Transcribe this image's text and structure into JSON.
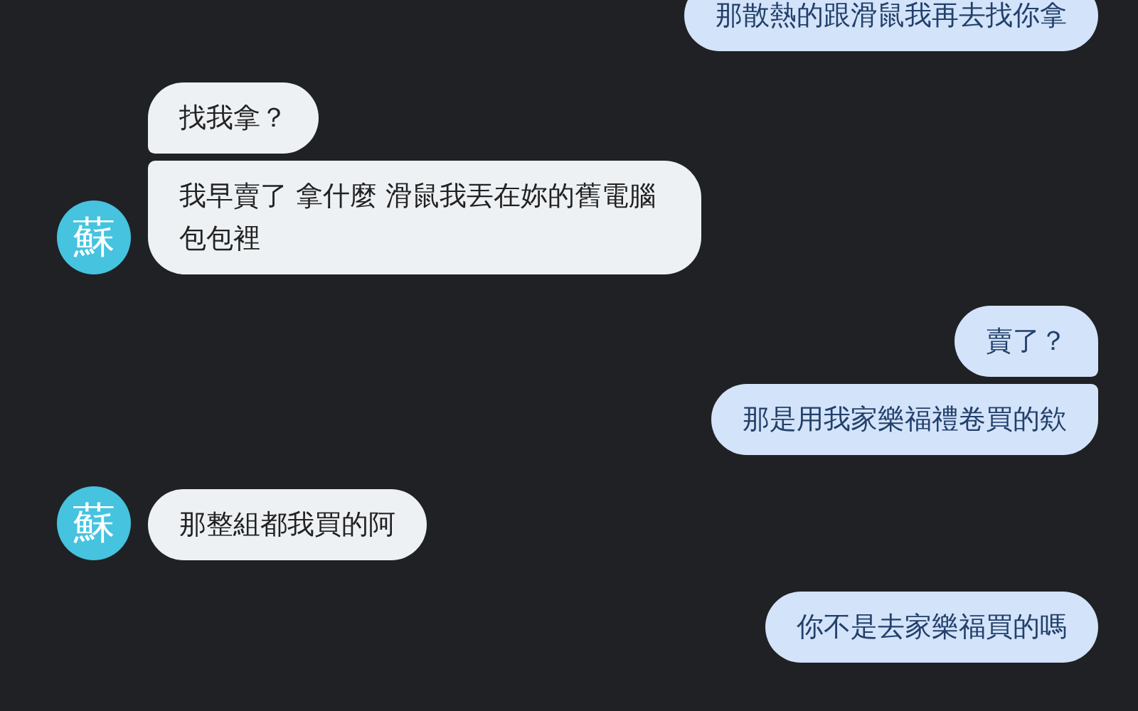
{
  "messages": [
    {
      "kind": "sent",
      "bubbles": [
        "那散熱的跟滑鼠我再去找你拿"
      ]
    },
    {
      "kind": "received",
      "avatar": "蘇",
      "bubbles": [
        "找我拿？",
        "我早賣了  拿什麼  滑鼠我丟在妳的舊電腦包包裡"
      ]
    },
    {
      "kind": "sent",
      "bubbles": [
        "賣了？",
        "那是用我家樂福禮卷買的欸"
      ]
    },
    {
      "kind": "received",
      "avatar": "蘇",
      "bubbles": [
        "那整組都我買的阿"
      ]
    },
    {
      "kind": "sent",
      "bubbles": [
        "你不是去家樂福買的嗎"
      ]
    }
  ]
}
